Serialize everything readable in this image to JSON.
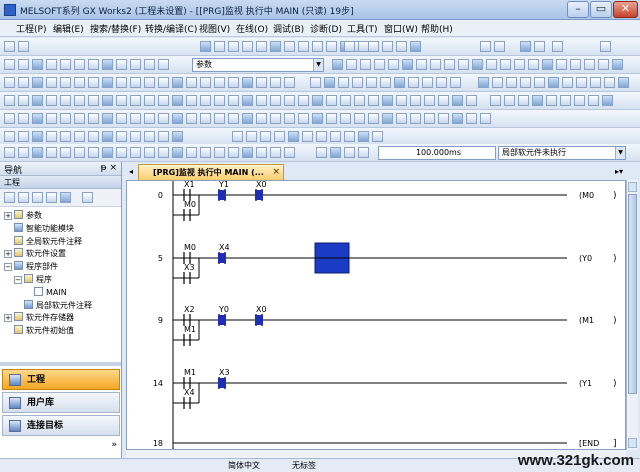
{
  "window": {
    "title": "MELSOFT系列 GX Works2 (工程未设置) - [[PRG]监视 执行中 MAIN (只读) 19步]"
  },
  "menu": [
    "工程(P)",
    "编辑(E)",
    "搜索/替换(F)",
    "转换/编译(C)",
    "视图(V)",
    "在线(O)",
    "调试(B)",
    "诊断(D)",
    "工具(T)",
    "窗口(W)",
    "帮助(H)"
  ],
  "toolbar": {
    "param_combo": "参数",
    "scan_time": "100.000ms",
    "local_device_status": "局部软元件未执行"
  },
  "navigation": {
    "title": "导航",
    "pin": "ᵽ ×",
    "section": "工程",
    "tree": [
      {
        "label": "参数",
        "level": 0,
        "expander": "+"
      },
      {
        "label": "智能功能模块",
        "level": 0,
        "expander": ""
      },
      {
        "label": "全局软元件注释",
        "level": 0,
        "expander": ""
      },
      {
        "label": "软元件设置",
        "level": 0,
        "expander": "+"
      },
      {
        "label": "程序部件",
        "level": 0,
        "expander": "−"
      },
      {
        "label": "程序",
        "level": 1,
        "expander": "−"
      },
      {
        "label": "MAIN",
        "level": 2,
        "expander": ""
      },
      {
        "label": "局部软元件注释",
        "level": 1,
        "expander": ""
      },
      {
        "label": "软元件存储器",
        "level": 0,
        "expander": "+"
      },
      {
        "label": "软元件初始值",
        "level": 0,
        "expander": ""
      }
    ],
    "tabs": [
      "工程",
      "用户库",
      "连接目标"
    ]
  },
  "editor": {
    "tab_label": "[PRG]监视 执行中 MAIN (...",
    "tab_close": "×",
    "rungs": [
      {
        "step": "0",
        "coil": "M0",
        "contacts": [
          {
            "label": "X1",
            "on": false
          },
          {
            "label": "Y1",
            "on": true
          },
          {
            "label": "X0",
            "on": true
          }
        ],
        "parallel": "M0"
      },
      {
        "step": "5",
        "coil": "Y0",
        "contacts": [
          {
            "label": "M0",
            "on": false
          },
          {
            "label": "X4",
            "on": true
          }
        ],
        "parallel": "X3"
      },
      {
        "step": "9",
        "coil": "M1",
        "contacts": [
          {
            "label": "X2",
            "on": false
          },
          {
            "label": "Y0",
            "on": true
          },
          {
            "label": "X0",
            "on": true
          }
        ],
        "parallel": "M1"
      },
      {
        "step": "14",
        "coil": "Y1",
        "contacts": [
          {
            "label": "M1",
            "on": false
          },
          {
            "label": "X3",
            "on": true
          }
        ],
        "parallel": "X4"
      },
      {
        "step": "18",
        "coil": "END",
        "contacts": [],
        "parallel": ""
      }
    ]
  },
  "statusbar": {
    "language": "简体中文",
    "label_text": "无标签"
  },
  "watermark": "www.321gk.com",
  "colors": {
    "monitor_on": "#1e2fb5",
    "cursor": "#1a3cc4",
    "active_tab": "#f5a623"
  }
}
